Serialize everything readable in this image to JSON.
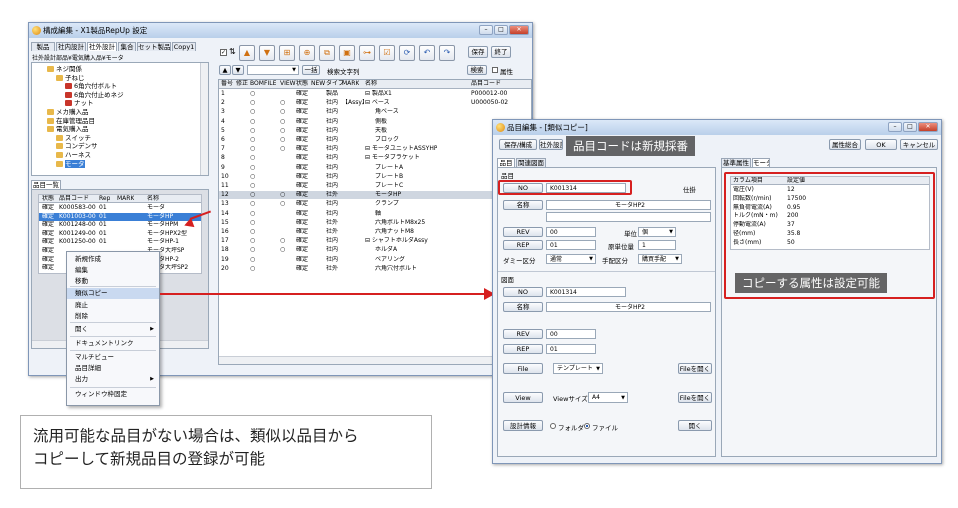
{
  "main_window": {
    "title": "構成編集 - X1製品RepUp 設定",
    "menu_title": "構成編集 - X1製品RepUp",
    "menu_extra": "設定",
    "tabs": [
      "製品",
      "社内設計",
      "社外設計",
      "集合",
      "セット製品",
      "Copy1"
    ],
    "breadcrumb": "社外設計部品¥電気購入品¥モータ",
    "tree": [
      {
        "label": "ネジ関係",
        "indent": 1
      },
      {
        "label": "子ねじ",
        "indent": 2
      },
      {
        "label": "6角穴付ボルト",
        "indent": 3
      },
      {
        "label": "6角穴付止めネジ",
        "indent": 3
      },
      {
        "label": "ナット",
        "indent": 3
      },
      {
        "label": "メカ購入品",
        "indent": 1
      },
      {
        "label": "在庫管理品目",
        "indent": 1
      },
      {
        "label": "電気購入品",
        "indent": 1
      },
      {
        "label": "スイッチ",
        "indent": 2
      },
      {
        "label": "コンデンサ",
        "indent": 2
      },
      {
        "label": "ハーネス",
        "indent": 2
      },
      {
        "label": "モータ",
        "indent": 2
      }
    ],
    "list_tab": "品目一覧",
    "list_headers": [
      "状態",
      "品目コード",
      "Rep",
      "MARK",
      "名称"
    ],
    "list_rows": [
      [
        "確定",
        "K000583-00",
        "01",
        "",
        "モータ"
      ],
      [
        "確定",
        "K001003-00",
        "01",
        "",
        "モータHP"
      ],
      [
        "確定",
        "K001248-00",
        "01",
        "",
        "モータHPM"
      ],
      [
        "確定",
        "K001249-00",
        "01",
        "",
        "モータHPX2型"
      ],
      [
        "確定",
        "K001250-00",
        "01",
        "",
        "モータHP-1"
      ],
      [
        "確定",
        "",
        "",
        "",
        "モータ大坪SP"
      ],
      [
        "確定",
        "",
        "",
        "",
        "モータHP-2"
      ],
      [
        "確定",
        "",
        "",
        "",
        "モータ大坪SP2"
      ]
    ],
    "toolbar": {
      "save": "保存",
      "end": "終了",
      "combo_value": "",
      "one_shot": "一括",
      "search_label": "検索文字列",
      "search_btn": "検索",
      "attr_label": "属性"
    },
    "grid_headers": [
      "番号",
      "修正",
      "BOM",
      "FILE",
      "VIEW",
      "状態",
      "NEW",
      "タイプ",
      "MARK",
      "名称",
      "品目コード"
    ],
    "grid_rows": [
      [
        "1",
        "",
        "○",
        "",
        "",
        "確定",
        "",
        "製品",
        "",
        "⊟ 製品X1",
        "P000012-00"
      ],
      [
        "2",
        "",
        "○",
        "",
        "○",
        "確定",
        "",
        "社内",
        "【Assy】",
        "⊟ ベース",
        "U000050-02"
      ],
      [
        "3",
        "",
        "○",
        "",
        "○",
        "確定",
        "",
        "社内",
        "",
        "角ベース",
        ""
      ],
      [
        "4",
        "",
        "○",
        "",
        "○",
        "確定",
        "",
        "社内",
        "",
        "側板",
        ""
      ],
      [
        "5",
        "",
        "○",
        "",
        "○",
        "確定",
        "",
        "社内",
        "",
        "天板",
        ""
      ],
      [
        "6",
        "",
        "○",
        "",
        "○",
        "確定",
        "",
        "社内",
        "",
        "ブロック",
        ""
      ],
      [
        "7",
        "",
        "○",
        "",
        "○",
        "確定",
        "",
        "社内",
        "",
        "⊟ モータユニットASSYHP",
        ""
      ],
      [
        "8",
        "",
        "○",
        "",
        "",
        "確定",
        "",
        "社内",
        "",
        "⊟ モータブラケット",
        ""
      ],
      [
        "9",
        "",
        "○",
        "",
        "",
        "確定",
        "",
        "社内",
        "",
        "プレートA",
        ""
      ],
      [
        "10",
        "",
        "○",
        "",
        "",
        "確定",
        "",
        "社内",
        "",
        "プレートB",
        ""
      ],
      [
        "11",
        "",
        "○",
        "",
        "",
        "確定",
        "",
        "社内",
        "",
        "プレートC",
        ""
      ],
      [
        "12",
        "",
        "○",
        "",
        "○",
        "確定",
        "",
        "社外",
        "",
        "モータHP",
        ""
      ],
      [
        "13",
        "",
        "○",
        "",
        "○",
        "確定",
        "",
        "社内",
        "",
        "クランプ",
        ""
      ],
      [
        "14",
        "",
        "○",
        "",
        "",
        "確定",
        "",
        "社内",
        "",
        "軸",
        ""
      ],
      [
        "15",
        "",
        "○",
        "",
        "",
        "確定",
        "",
        "社外",
        "",
        "六角ボルトM8x25",
        ""
      ],
      [
        "16",
        "",
        "○",
        "",
        "",
        "確定",
        "",
        "社外",
        "",
        "六角ナットM8",
        ""
      ],
      [
        "17",
        "",
        "○",
        "",
        "○",
        "確定",
        "",
        "社内",
        "",
        "⊟ シャフトホルダAssy",
        ""
      ],
      [
        "18",
        "",
        "○",
        "",
        "○",
        "確定",
        "",
        "社内",
        "",
        "ホルダA",
        ""
      ],
      [
        "19",
        "",
        "○",
        "",
        "",
        "確定",
        "",
        "社内",
        "",
        "ベアリング",
        ""
      ],
      [
        "20",
        "",
        "○",
        "",
        "",
        "確定",
        "",
        "社外",
        "",
        "六角穴付ボルト",
        ""
      ]
    ]
  },
  "context_menu": {
    "items": [
      "新規作成",
      "編集",
      "移動",
      "類似コピー",
      "廃止",
      "削除",
      "開く",
      "ドキュメントリンク",
      "マルチビュー",
      "品目詳細",
      "出力",
      "ウィンドウ枠固定"
    ]
  },
  "dialog": {
    "title": "品目編集 - [類似コピー]",
    "btn_save_close": "保存/構成",
    "btn_external": "社外設計",
    "btn_attr": "属性総合",
    "btn_ok": "OK",
    "btn_cancel": "キャンセル",
    "tabs_left": [
      "品目",
      "関連図面"
    ],
    "tabs_right": [
      "基準属性",
      "モータ"
    ],
    "item_group": "品目",
    "no_label": "NO",
    "no_value": "K001314",
    "no_flag": "仕掛",
    "name_label": "名称",
    "name_value": "モータHP2",
    "rev_label": "REV",
    "rev_value": "00",
    "unit_label": "単位",
    "unit_value": "個",
    "rep_label": "REP",
    "rep_value": "01",
    "qty_label": "原単位量",
    "qty_value": "1",
    "dummy_label": "ダミー区分",
    "dummy_value": "通常",
    "arrange_label": "手配区分",
    "arrange_value": "購買手配",
    "drawing_group": "図面",
    "d_no_value": "K001314",
    "d_name_value": "モータHP2",
    "d_rev_value": "00",
    "d_rep_value": "01",
    "file_label": "File",
    "template_label": "テンプレート",
    "file_open": "Fileを開く",
    "view_label": "View",
    "view_size_label": "Viewサイズ",
    "view_size_value": "A4",
    "design_info": "設計情報",
    "radio_folder": "フォルダ",
    "radio_file": "ファイル",
    "open_label": "開く",
    "attr_headers": [
      "カラム項目",
      "設定値"
    ],
    "attrs": [
      [
        "電圧(V)",
        "12"
      ],
      [
        "回転数(r/min)",
        "17500"
      ],
      [
        "無負荷電流(A)",
        "0.95"
      ],
      [
        "トルク(mN・m)",
        "200"
      ],
      [
        "停動電流(A)",
        "37"
      ],
      [
        "径(mm)",
        "35.8"
      ],
      [
        "長さ(mm)",
        "50"
      ]
    ]
  },
  "callouts": {
    "new_code": "品目コードは新規採番",
    "copy_attr": "コピーする属性は設定可能"
  },
  "note": {
    "line1": "流用可能な品目がない場合は、類似以品目から",
    "line2": "コピーして新規品目の登録が可能"
  },
  "colors": {
    "highlight": "#d62020",
    "selected_row": "#3a7fd6",
    "toolbar_icon": "#f0a020"
  }
}
